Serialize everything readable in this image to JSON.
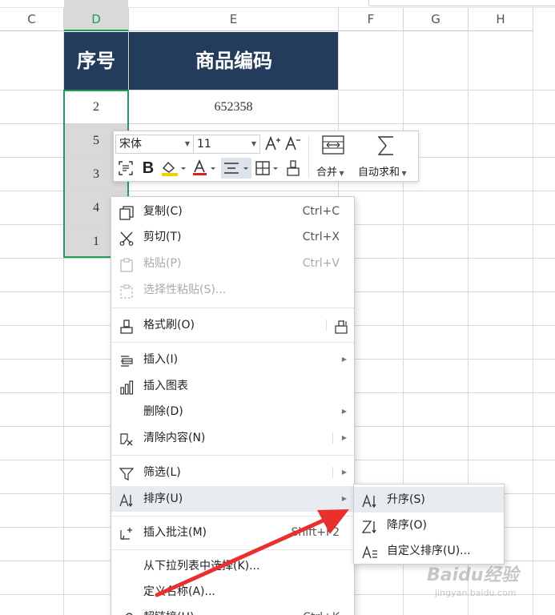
{
  "columns": [
    "C",
    "D",
    "E",
    "F",
    "G",
    "H"
  ],
  "selected_column": "D",
  "table": {
    "headers": [
      "序号",
      "商品编码"
    ],
    "rows": [
      {
        "seq": "2",
        "code": "652358"
      },
      {
        "seq": "5",
        "code": ""
      },
      {
        "seq": "3",
        "code": ""
      },
      {
        "seq": "4",
        "code": ""
      },
      {
        "seq": "1",
        "code": ""
      }
    ]
  },
  "mini_toolbar": {
    "font_name": "宋体",
    "font_size": "11",
    "merge_label": "合并",
    "autosum_label": "自动求和",
    "font_color": "#e02020",
    "highlight_color": "#f0d000",
    "icons": [
      "increase-font-icon",
      "decrease-font-icon",
      "merge-cells-icon",
      "sigma-icon",
      "format-cells-icon",
      "bold-icon",
      "fill-color-icon",
      "font-color-icon",
      "align-center-icon",
      "border-icon",
      "format-painter-icon"
    ]
  },
  "context_menu": {
    "items": [
      {
        "label": "复制(C)",
        "shortcut": "Ctrl+C",
        "icon": "copy-icon",
        "enabled": true
      },
      {
        "label": "剪切(T)",
        "shortcut": "Ctrl+X",
        "icon": "scissors-icon",
        "enabled": true
      },
      {
        "label": "粘贴(P)",
        "shortcut": "Ctrl+V",
        "icon": "paste-icon",
        "enabled": false
      },
      {
        "label": "选择性粘贴(S)...",
        "shortcut": "",
        "icon": "paste-special-icon",
        "enabled": false
      },
      {
        "label": "格式刷(O)",
        "shortcut": "",
        "icon": "format-painter-icon",
        "enabled": true
      },
      {
        "label": "插入(I)",
        "shortcut": "",
        "icon": "insert-icon",
        "enabled": true
      },
      {
        "label": "插入图表",
        "shortcut": "",
        "icon": "chart-icon",
        "enabled": true
      },
      {
        "label": "删除(D)",
        "shortcut": "",
        "icon": "",
        "enabled": true
      },
      {
        "label": "清除内容(N)",
        "shortcut": "",
        "icon": "eraser-icon",
        "enabled": true
      },
      {
        "label": "筛选(L)",
        "shortcut": "",
        "icon": "filter-icon",
        "enabled": true
      },
      {
        "label": "排序(U)",
        "shortcut": "",
        "icon": "sort-icon",
        "enabled": true
      },
      {
        "label": "插入批注(M)",
        "shortcut": "Shift+F2",
        "icon": "comment-icon",
        "enabled": true
      },
      {
        "label": "从下拉列表中选择(K)...",
        "shortcut": "",
        "icon": "",
        "enabled": true
      },
      {
        "label": "定义名称(A)...",
        "shortcut": "",
        "icon": "",
        "enabled": true
      },
      {
        "label": "超链接(H)...",
        "shortcut": "Ctrl+K",
        "icon": "link-icon",
        "enabled": true
      }
    ]
  },
  "sort_submenu": {
    "items": [
      {
        "label": "升序(S)",
        "icon": "sort-ascending-icon"
      },
      {
        "label": "降序(O)",
        "icon": "sort-descending-icon"
      },
      {
        "label": "自定义排序(U)...",
        "icon": "custom-sort-icon"
      }
    ]
  },
  "annotation": {
    "arrow_color": "#e8312f"
  },
  "watermark": {
    "line1": "Baidu经验",
    "line2": "jingyan.baidu.com"
  }
}
